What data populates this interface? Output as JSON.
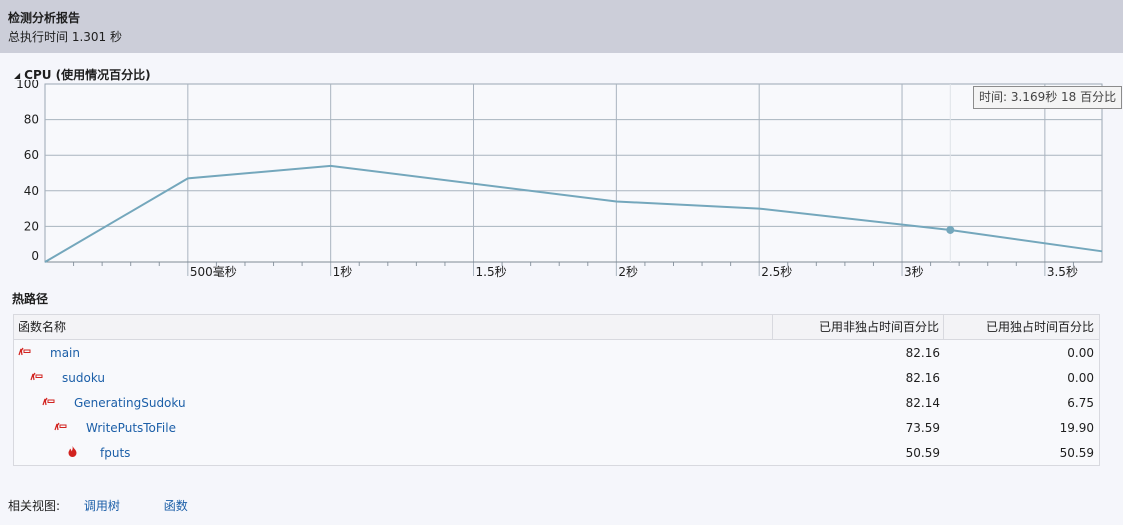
{
  "header": {
    "title": "检测分析报告",
    "subtitle": "总执行时间 1.301 秒"
  },
  "cpu_section": {
    "title": "CPU (使用情况百分比)",
    "collapse_glyph": "◢"
  },
  "tooltip": "时间: 3.169秒 18 百分比",
  "chart_data": {
    "type": "line",
    "title": "CPU (使用情况百分比)",
    "ylim": [
      0,
      100
    ],
    "y_ticks": [
      "0",
      "20",
      "40",
      "60",
      "80",
      "100"
    ],
    "xlim": [
      0,
      3.7
    ],
    "x_tick_values": [
      0.5,
      1,
      1.5,
      2,
      2.5,
      3,
      3.5
    ],
    "x_tick_labels": [
      "500毫秒",
      "1秒",
      "1.5秒",
      "2秒",
      "2.5秒",
      "3秒",
      "3.5秒"
    ],
    "grid": true,
    "series": [
      {
        "x": [
          0,
          0.5,
          1.0,
          2.0,
          2.5,
          3.169,
          3.7
        ],
        "y": [
          0,
          47,
          54,
          34,
          30,
          18,
          6
        ]
      }
    ],
    "highlight": {
      "x": 3.169,
      "y": 18
    },
    "line_color": "#74a7bc"
  },
  "hot_path": {
    "title": "热路径",
    "columns": [
      "函数名称",
      "已用非独占时间百分比",
      "已用独占时间百分比"
    ],
    "rows": [
      {
        "name": "main",
        "inclusive": "82.16",
        "exclusive": "0.00",
        "icon": "hot-path-arrow-icon"
      },
      {
        "name": "sudoku",
        "inclusive": "82.16",
        "exclusive": "0.00",
        "icon": "hot-path-arrow-icon"
      },
      {
        "name": "GeneratingSudoku",
        "inclusive": "82.14",
        "exclusive": "6.75",
        "icon": "hot-path-arrow-icon"
      },
      {
        "name": "WritePutsToFile",
        "inclusive": "73.59",
        "exclusive": "19.90",
        "icon": "hot-path-arrow-icon"
      },
      {
        "name": "fputs",
        "inclusive": "50.59",
        "exclusive": "50.59",
        "icon": "flame-icon"
      }
    ]
  },
  "footer": {
    "label": "相关视图:",
    "link_call_tree": "调用树",
    "link_functions": "函数"
  }
}
